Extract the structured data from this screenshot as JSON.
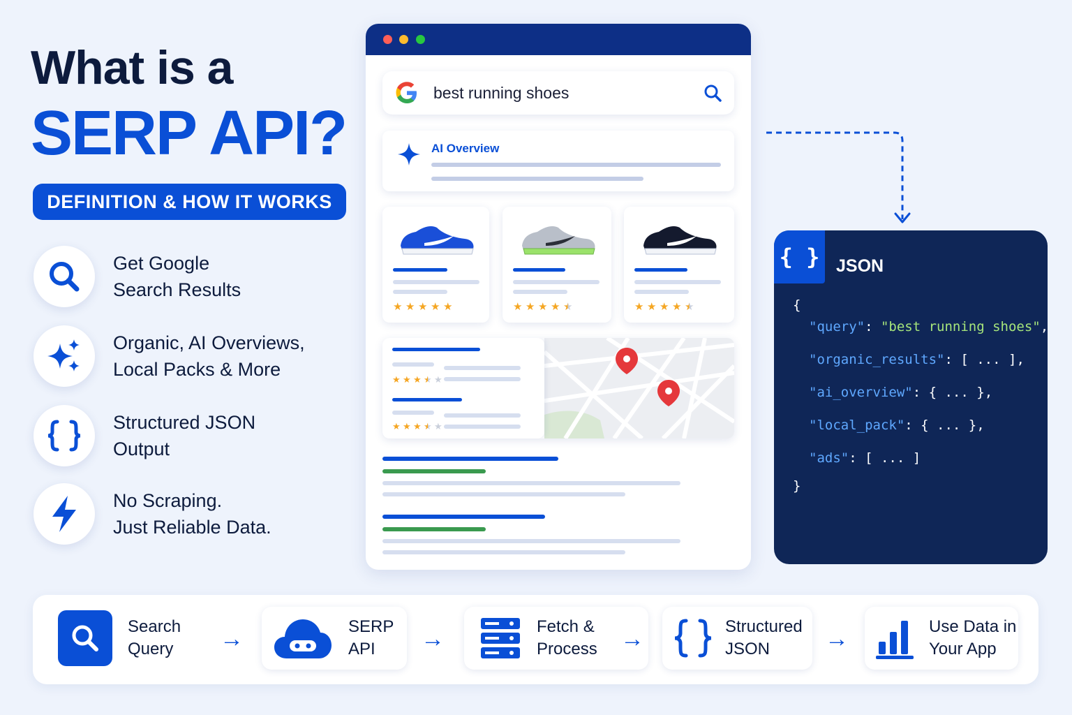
{
  "heading": {
    "line1": "What is a",
    "line2": "SERP API?",
    "badge": "DEFINITION & HOW IT WORKS"
  },
  "features": [
    {
      "icon": "search-icon",
      "line1": "Get Google",
      "line2": "Search Results"
    },
    {
      "icon": "sparkle-icon",
      "line1": "Organic, AI Overviews,",
      "line2": "Local Packs & More"
    },
    {
      "icon": "braces-icon",
      "line1": "Structured JSON",
      "line2": "Output"
    },
    {
      "icon": "lightning-icon",
      "line1": "No Scraping.",
      "line2": "Just Reliable Data."
    }
  ],
  "browser": {
    "search_query": "best running shoes",
    "ai_overview_label": "AI Overview",
    "product_ratings": [
      5,
      4.5,
      4.5
    ],
    "local_ratings": [
      3.5,
      3.5
    ]
  },
  "json_panel": {
    "icon_glyph": "{ }",
    "title": "JSON",
    "open": "{",
    "lines": [
      {
        "key": "\"query\"",
        "sep": ": ",
        "value": "\"best running shoes\"",
        "tail": ","
      },
      {
        "key": "\"organic_results\"",
        "sep": ": ",
        "value": "[ ... ]",
        "tail": ","
      },
      {
        "key": "\"ai_overview\"",
        "sep": ": ",
        "value": "{ ... }",
        "tail": ","
      },
      {
        "key": "\"local_pack\"",
        "sep": ": ",
        "value": "{ ... }",
        "tail": ","
      },
      {
        "key": "\"ads\"",
        "sep": ": ",
        "value": "[ ... ]",
        "tail": ""
      }
    ],
    "close": "}"
  },
  "pipeline": [
    {
      "icon": "search-icon",
      "line1": "Search",
      "line2": "Query"
    },
    {
      "icon": "cloud-robot-icon",
      "line1": "SERP",
      "line2": "API"
    },
    {
      "icon": "server-icon",
      "line1": "Fetch &",
      "line2": "Process"
    },
    {
      "icon": "braces-icon",
      "line1": "Structured",
      "line2": "JSON"
    },
    {
      "icon": "bar-chart-icon",
      "line1": "Use Data in",
      "line2": "Your App"
    }
  ],
  "arrow_glyph": "→",
  "colors": {
    "brand_blue": "#0a4fd6",
    "navy": "#0d2f86",
    "json_bg": "#0f2657",
    "json_key": "#5fa8ff",
    "json_string": "#a6e57b",
    "star": "#f5a623",
    "result_green": "#3a9a4f",
    "pin_red": "#e5383b"
  }
}
